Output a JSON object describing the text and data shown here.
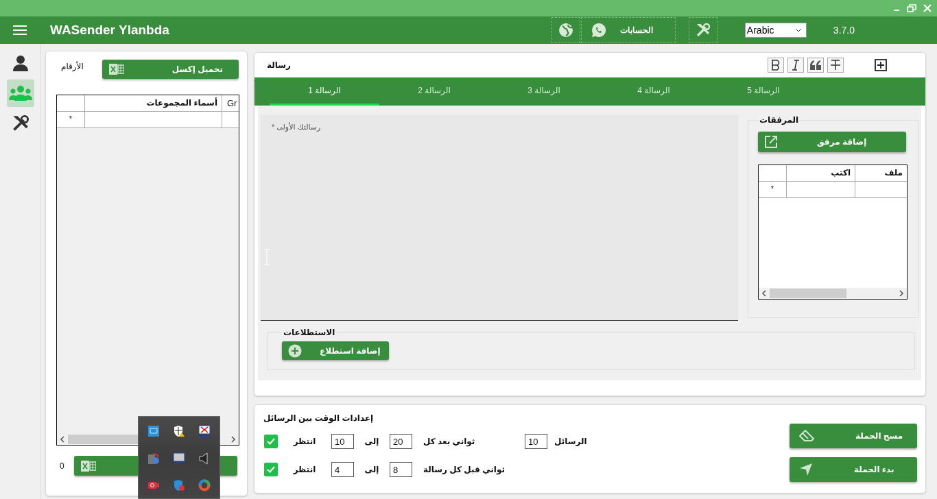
{
  "header": {
    "title": "WASender Ylanbda",
    "accounts_label": "الحسابات",
    "language": "Arabic",
    "version": "3.7.0"
  },
  "sidebar": {
    "items": [
      {
        "kind": "user",
        "selected": false
      },
      {
        "kind": "group",
        "selected": true
      },
      {
        "kind": "tools",
        "selected": false
      }
    ]
  },
  "numbers_panel": {
    "title": "الأرقام",
    "load_button": "تحميل إكسل",
    "table": {
      "columns": [
        "Gr",
        "أسماء المجموعات"
      ],
      "new_row_marker": "*"
    },
    "count": "0"
  },
  "message_panel": {
    "title": "رسالة",
    "tabs": [
      {
        "label": "الرسالة 5",
        "selected": false
      },
      {
        "label": "الرسالة 4",
        "selected": false
      },
      {
        "label": "الرسالة 3",
        "selected": false
      },
      {
        "label": "الرسالة 2",
        "selected": false
      },
      {
        "label": "الرسالة 1",
        "selected": true
      }
    ],
    "editor": {
      "placeholder": "رسالتك الأولى *"
    },
    "attachments": {
      "title": "المرفقات",
      "add_button": "إضافة مرفق",
      "columns": [
        "ملف",
        "اكتب"
      ],
      "new_row_marker": "*"
    },
    "polls": {
      "title": "الاستطلاعات",
      "add_button": "إضافة استطلاع"
    }
  },
  "time_settings": {
    "title": "إعدادات الوقت بين الرسائل",
    "rows": [
      {
        "checked": true,
        "wait_label": "انتظر",
        "from": "10",
        "to_label": "إلى",
        "to": "20",
        "unit_label": "ثواني بعد كل",
        "count": "10",
        "count_label": "الرسائل"
      },
      {
        "checked": true,
        "wait_label": "انتظر",
        "from": "4",
        "to_label": "إلى",
        "to": "8",
        "unit_label": "ثواني قبل كل رسالة"
      }
    ],
    "clear_button": "مسح الحملة",
    "start_button": "بدء الحملة"
  }
}
